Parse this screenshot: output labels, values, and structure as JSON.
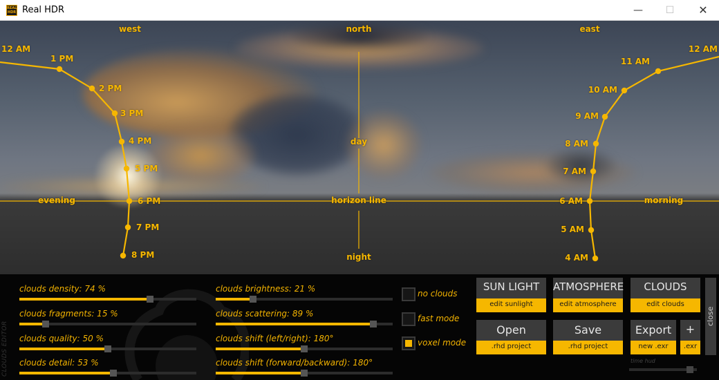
{
  "window": {
    "icon_text": "REAL HDR",
    "title": "Real HDR",
    "minimize": "—",
    "maximize": "☐",
    "close": "✕"
  },
  "compass": {
    "west": "west",
    "north": "north",
    "east": "east"
  },
  "markers": {
    "day": "day",
    "night": "night",
    "horizon": "horizon line",
    "evening": "evening",
    "morning": "morning"
  },
  "evening_hours": [
    {
      "label": "12 AM"
    },
    {
      "label": "1 PM"
    },
    {
      "label": "2 PM"
    },
    {
      "label": "3 PM"
    },
    {
      "label": "4 PM"
    },
    {
      "label": "5 PM"
    },
    {
      "label": "6 PM"
    },
    {
      "label": "7 PM"
    },
    {
      "label": "8 PM"
    }
  ],
  "morning_hours": [
    {
      "label": "12 AM"
    },
    {
      "label": "11 AM"
    },
    {
      "label": "10 AM"
    },
    {
      "label": "9 AM"
    },
    {
      "label": "8 AM"
    },
    {
      "label": "7 AM"
    },
    {
      "label": "6 AM"
    },
    {
      "label": "5 AM"
    },
    {
      "label": "4 AM"
    }
  ],
  "editor": {
    "side_label": "CLOUDS EDITOR",
    "sliders_left": [
      {
        "label": "clouds density: 74 %",
        "value": 0.74
      },
      {
        "label": "clouds fragments: 15 %",
        "value": 0.15
      },
      {
        "label": "clouds quality: 50 %",
        "value": 0.5
      },
      {
        "label": "clouds detail: 53 %",
        "value": 0.53
      }
    ],
    "sliders_right": [
      {
        "label": "clouds brightness: 21 %",
        "value": 0.21
      },
      {
        "label": "clouds scattering: 89 %",
        "value": 0.89
      },
      {
        "label": "clouds shift (left/right): 180°",
        "value": 0.5
      },
      {
        "label": "clouds shift (forward/backward): 180°",
        "value": 0.5
      }
    ],
    "checkboxes": [
      {
        "label": "no clouds",
        "checked": false
      },
      {
        "label": "fast mode",
        "checked": false
      },
      {
        "label": "voxel mode",
        "checked": true
      }
    ]
  },
  "buttons": {
    "sun_light": "SUN LIGHT",
    "edit_sunlight": "edit sunlight",
    "atmosphere": "ATMOSPHERE",
    "edit_atmosphere": "edit atmosphere",
    "clouds": "CLOUDS",
    "edit_clouds": "edit clouds",
    "open": "Open",
    "open_sub": ".rhd project",
    "save": "Save",
    "save_sub": ".rhd project",
    "export": "Export",
    "export_sub": "new .exr",
    "plus": "+",
    "plus_sub": ".exr",
    "close": "close",
    "time_hud": "time hud",
    "time_hud_value": 0.9
  },
  "colors": {
    "accent": "#f6b700",
    "panel": "#050505",
    "button": "#3b3b3b"
  }
}
